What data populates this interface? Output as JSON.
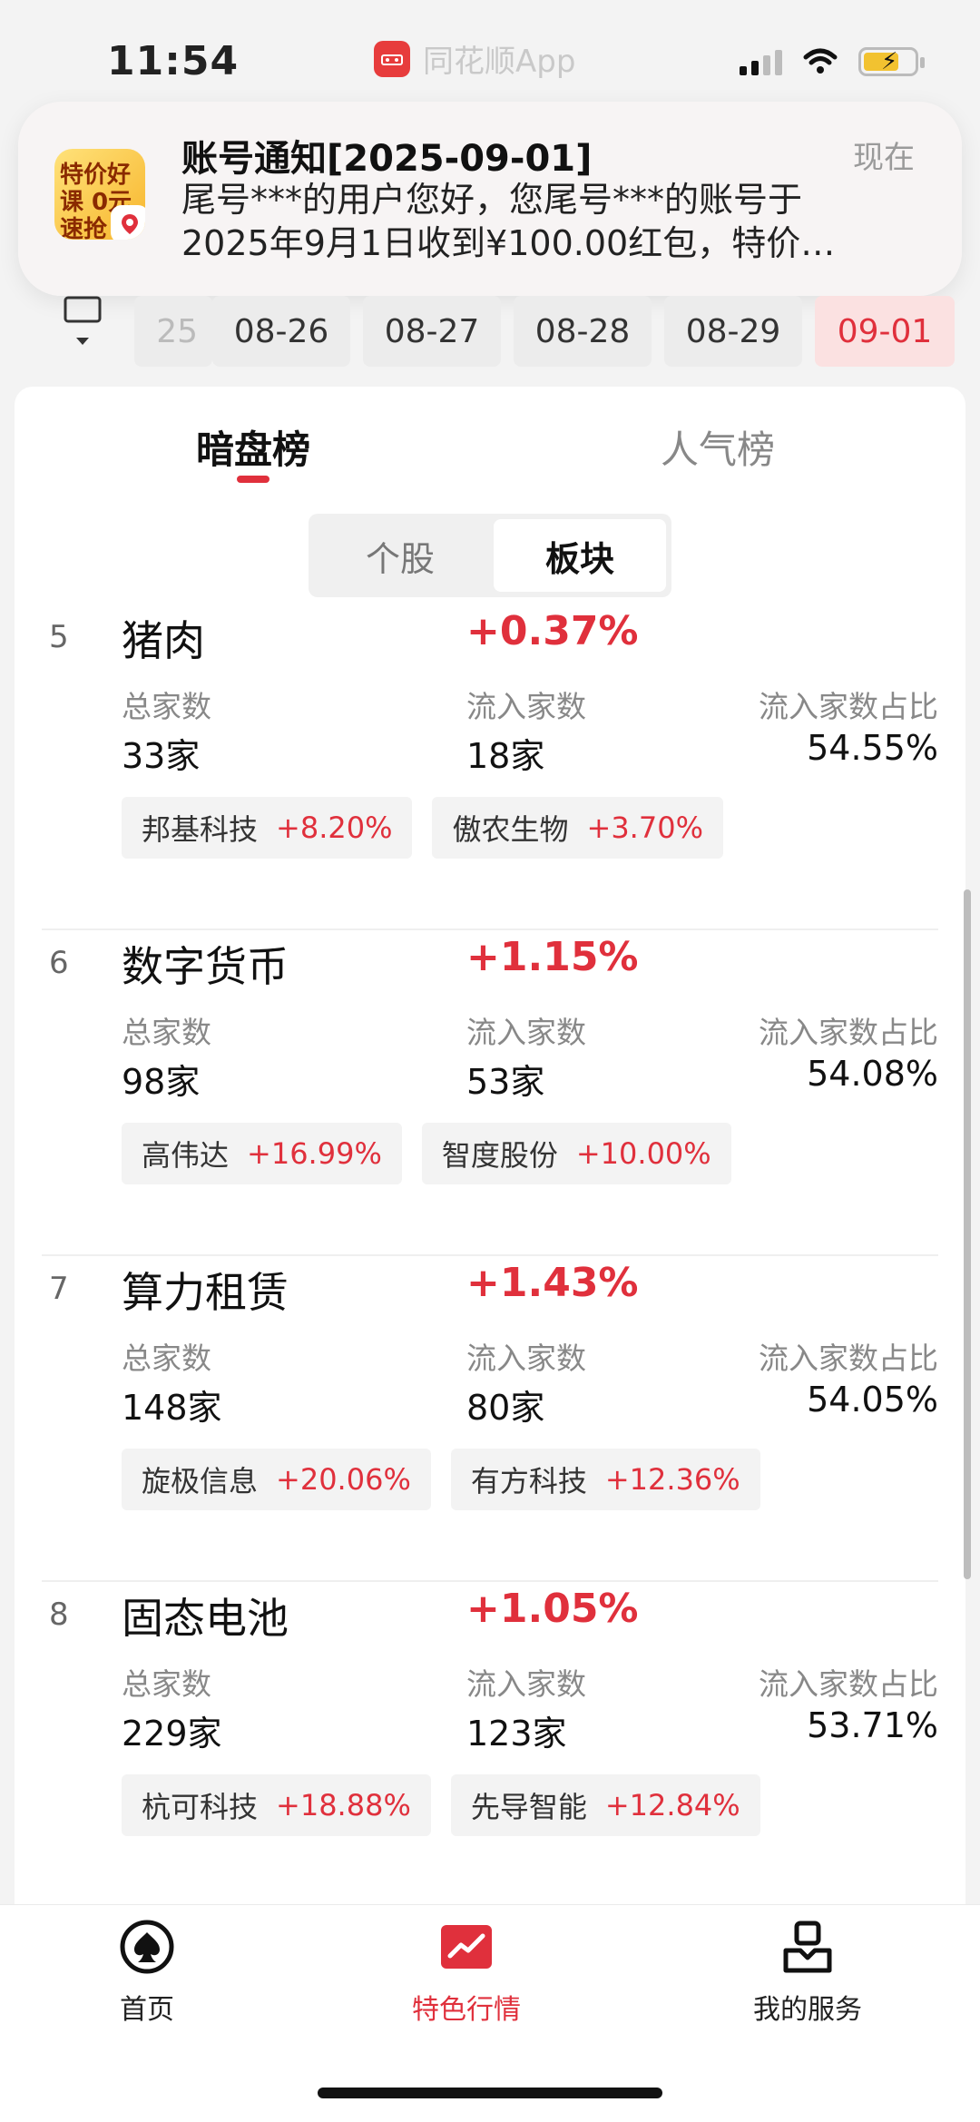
{
  "status_bar": {
    "time": "11:54",
    "app_name": "同花顺App"
  },
  "notification": {
    "title": "账号通知[2025-09-01]",
    "when": "现在",
    "line1": "尾号***的用户您好，您尾号***的账号于",
    "line2": "2025年9月1日收到¥100.00红包，特价…",
    "avatar_text": "特价好课 0元速抢"
  },
  "dates": [
    {
      "label": "25",
      "active": false
    },
    {
      "label": "08-26",
      "active": false
    },
    {
      "label": "08-27",
      "active": false
    },
    {
      "label": "08-28",
      "active": false
    },
    {
      "label": "08-29",
      "active": false
    },
    {
      "label": "09-01",
      "active": true
    }
  ],
  "tabs": {
    "left": "暗盘榜",
    "right": "人气榜"
  },
  "segment": {
    "stocks": "个股",
    "sectors": "板块"
  },
  "labels": {
    "total": "总家数",
    "inflow": "流入家数",
    "ratio": "流入家数占比"
  },
  "items": [
    {
      "rank": "5",
      "name": "猪肉",
      "change": "+0.37%",
      "total": "33家",
      "inflow": "18家",
      "ratio": "54.55%",
      "chips": [
        {
          "name": "邦基科技",
          "pct": "+8.20%"
        },
        {
          "name": "傲农生物",
          "pct": "+3.70%"
        }
      ]
    },
    {
      "rank": "6",
      "name": "数字货币",
      "change": "+1.15%",
      "total": "98家",
      "inflow": "53家",
      "ratio": "54.08%",
      "chips": [
        {
          "name": "高伟达",
          "pct": "+16.99%"
        },
        {
          "name": "智度股份",
          "pct": "+10.00%"
        }
      ]
    },
    {
      "rank": "7",
      "name": "算力租赁",
      "change": "+1.43%",
      "total": "148家",
      "inflow": "80家",
      "ratio": "54.05%",
      "chips": [
        {
          "name": "旋极信息",
          "pct": "+20.06%"
        },
        {
          "name": "有方科技",
          "pct": "+12.36%"
        }
      ]
    },
    {
      "rank": "8",
      "name": "固态电池",
      "change": "+1.05%",
      "total": "229家",
      "inflow": "123家",
      "ratio": "53.71%",
      "chips": [
        {
          "name": "杭可科技",
          "pct": "+18.88%"
        },
        {
          "name": "先导智能",
          "pct": "+12.84%"
        }
      ]
    }
  ],
  "bottom_nav": {
    "home": "首页",
    "featured": "特色行情",
    "services": "我的服务"
  },
  "colors": {
    "accent_red": "#e0303c",
    "battery": "#f2c230"
  }
}
